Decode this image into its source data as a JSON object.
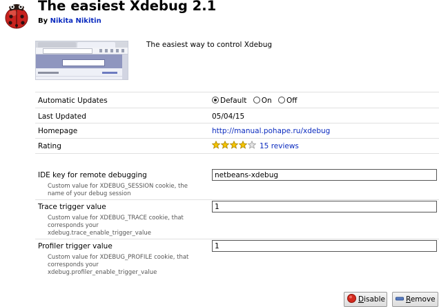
{
  "addon": {
    "title": "The easiest Xdebug 2.1",
    "by_label": "By",
    "author": "Nikita Nikitin",
    "description": "The easiest way to control Xdebug",
    "icon": "ladybug-icon"
  },
  "details": {
    "automatic_updates": {
      "label": "Automatic Updates",
      "options": [
        "Default",
        "On",
        "Off"
      ],
      "selected": "Default"
    },
    "last_updated": {
      "label": "Last Updated",
      "value": "05/04/15"
    },
    "homepage": {
      "label": "Homepage",
      "value": "http://manual.pohape.ru/xdebug"
    },
    "rating": {
      "label": "Rating",
      "stars": 4,
      "max_stars": 5,
      "reviews": "15 reviews"
    }
  },
  "preferences": [
    {
      "label": "IDE key for remote debugging",
      "description": "Custom value for XDEBUG_SESSION cookie, the name of your debug session",
      "value": "netbeans-xdebug"
    },
    {
      "label": "Trace trigger value",
      "description": "Custom value for XDEBUG_TRACE cookie, that corresponds your xdebug.trace_enable_trigger_value",
      "value": "1"
    },
    {
      "label": "Profiler trigger value",
      "description": "Custom value for XDEBUG_PROFILE cookie, that corresponds your xdebug.profiler_enable_trigger_value",
      "value": "1"
    }
  ],
  "actions": {
    "disable_mnemonic": "D",
    "disable_rest": "isable",
    "remove_mnemonic": "R",
    "remove_rest": "emove"
  },
  "colors": {
    "link": "#0b2bbf",
    "separator": "#e0e0e0"
  }
}
